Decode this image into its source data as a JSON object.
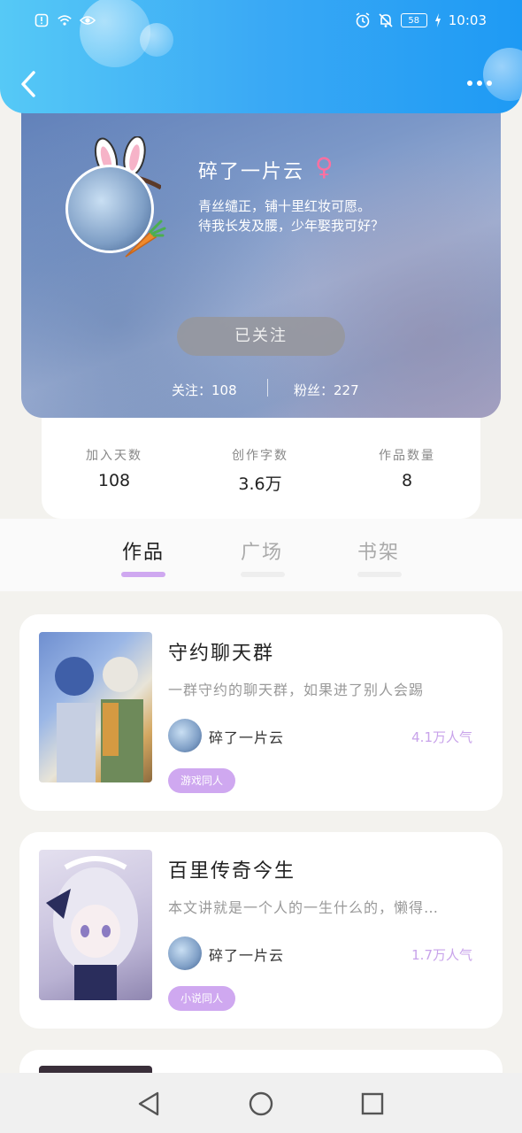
{
  "status_bar": {
    "time": "10:03",
    "battery": "58",
    "icons": [
      "alert-icon",
      "wifi-icon",
      "eye-icon",
      "alarm-icon",
      "mute-icon",
      "battery-icon",
      "charging-icon"
    ]
  },
  "header": {
    "back_icon": "chevron-left-icon",
    "more_icon": "more-dots-icon"
  },
  "profile": {
    "username": "碎了一片云",
    "gender_symbol": "♀",
    "bio_line1": "青丝缱正，铺十里红妆可愿。",
    "bio_line2": "待我长发及腰，少年娶我可好？",
    "follow_button": "已关注",
    "following_label": "关注：108",
    "fans_label": "粉丝：227"
  },
  "info": [
    {
      "label": "加入天数",
      "value": "108"
    },
    {
      "label": "创作字数",
      "value": "3.6万"
    },
    {
      "label": "作品数量",
      "value": "8"
    }
  ],
  "tabs": [
    {
      "label": "作品",
      "active": true
    },
    {
      "label": "广场",
      "active": false
    },
    {
      "label": "书架",
      "active": false
    }
  ],
  "works": [
    {
      "title": "守约聊天群",
      "description": "一群守约的聊天群，如果进了别人会踢",
      "author": "碎了一片云",
      "popularity": "4.1万人气",
      "tag": "游戏同人"
    },
    {
      "title": "百里传奇今生",
      "description": "本文讲就是一个人的一生什么的，懒得…",
      "author": "碎了一片云",
      "popularity": "1.7万人气",
      "tag": "小说同人"
    }
  ],
  "colors": {
    "accent": "#cfa8f0",
    "header_blue": "#3aa9f5",
    "gender_pink": "#ff6fa0"
  }
}
